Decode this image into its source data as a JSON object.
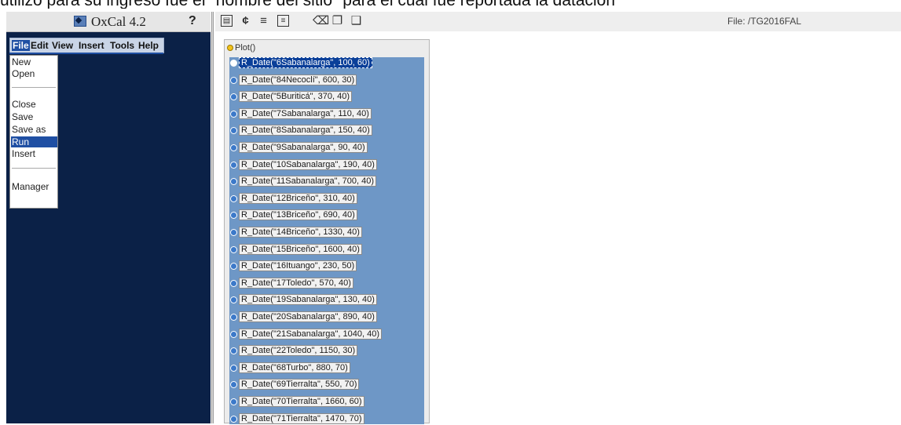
{
  "caption": "utilizó para su ingreso fue el \"nombre del sitio\" para el cual fue reportada la datación",
  "app": {
    "title": "OxCal 4.2",
    "help_label": "?",
    "logo_icon": "oxcal-logo-icon"
  },
  "menubar": [
    "File",
    "Edit",
    "View",
    "Insert",
    "Tools",
    "Help"
  ],
  "file_menu": {
    "groups": [
      [
        "New",
        "Open"
      ],
      [
        "Close",
        "Save",
        "Save as",
        "Run",
        "Insert"
      ],
      [
        "Manager"
      ]
    ],
    "active": "Run"
  },
  "toolbar": {
    "icons": [
      "view-icon",
      "calc-icon",
      "list-icon",
      "text-icon",
      "delete-icon",
      "copy-icon",
      "paste-icon"
    ],
    "file_label": "File: /TG2016FAL"
  },
  "tree": {
    "root": "Plot()",
    "items": [
      "R_Date(\"6Sabanalarga\", 100, 60)",
      "R_Date(\"84Necoclí\", 600, 30)",
      "R_Date(\"5Buriticá\", 370, 40)",
      "R_Date(\"7Sabanalarga\", 110, 40)",
      "R_Date(\"8Sabanalarga\", 150, 40)",
      "R_Date(\"9Sabanalarga\", 90, 40)",
      "R_Date(\"10Sabanalarga\", 190, 40)",
      "R_Date(\"11Sabanalarga\", 700, 40)",
      "R_Date(\"12Briceño\", 310, 40)",
      "R_Date(\"13Briceño\", 690, 40)",
      "R_Date(\"14Briceño\", 1330, 40)",
      "R_Date(\"15Briceño\", 1600, 40)",
      "R_Date(\"16Ituango\", 230, 50)",
      "R_Date(\"17Toledo\", 570, 40)",
      "R_Date(\"19Sabanalarga\", 130, 40)",
      "R_Date(\"20Sabanalarga\", 890, 40)",
      "R_Date(\"21Sabanalarga\", 1040, 40)",
      "R_Date(\"22Toledo\", 1150, 30)",
      "R_Date(\"68Turbo\", 880, 70)",
      "R_Date(\"69Tierralta\", 550, 70)",
      "R_Date(\"70Tierralta\", 1660, 60)",
      "R_Date(\"71Tierralta\", 1470, 70)"
    ],
    "selected_index": 0
  }
}
